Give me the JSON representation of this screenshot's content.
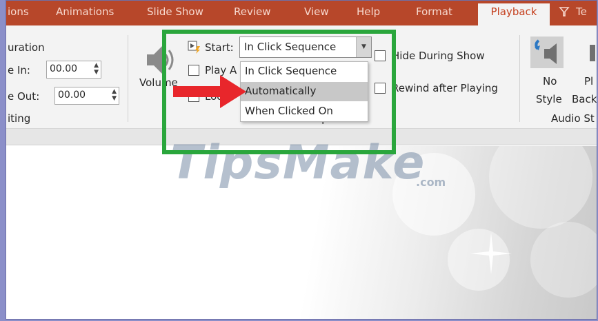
{
  "tabs": [
    {
      "label": "ions"
    },
    {
      "label": "Animations"
    },
    {
      "label": "Slide Show"
    },
    {
      "label": "Review"
    },
    {
      "label": "View"
    },
    {
      "label": "Help"
    },
    {
      "label": "Format"
    },
    {
      "label": "Playback",
      "active": true
    },
    {
      "label": "Te"
    }
  ],
  "editing": {
    "duration_label": "uration",
    "fade_in_label": "e In:",
    "fade_in_value": "00.00",
    "fade_out_label": "e Out:",
    "fade_out_value": "00.00",
    "group_label": "iting"
  },
  "volume": {
    "label": "Volume"
  },
  "audio_options": {
    "start_label": "Start:",
    "start_value": "In Click Sequence",
    "play_across_label": "Play A",
    "loop_label": "Loo",
    "hide_label": "Hide During Show",
    "rewind_label": "Rewind after Playing",
    "group_label": "Audio Options",
    "dropdown_options": [
      "In Click Sequence",
      "Automatically",
      "When Clicked On"
    ],
    "highlighted_option": "Automatically"
  },
  "audio_styles": {
    "no_style_line1": "No",
    "no_style_line2": "Style",
    "play_bg_line1": "Pl",
    "play_bg_line2": "Back",
    "group_label": "Audio St"
  },
  "watermark": {
    "text": "TipsMake",
    "suffix": ".com"
  },
  "colors": {
    "accent": "#b7472a",
    "highlight_box": "#2aa63c",
    "arrow": "#e8262b"
  }
}
